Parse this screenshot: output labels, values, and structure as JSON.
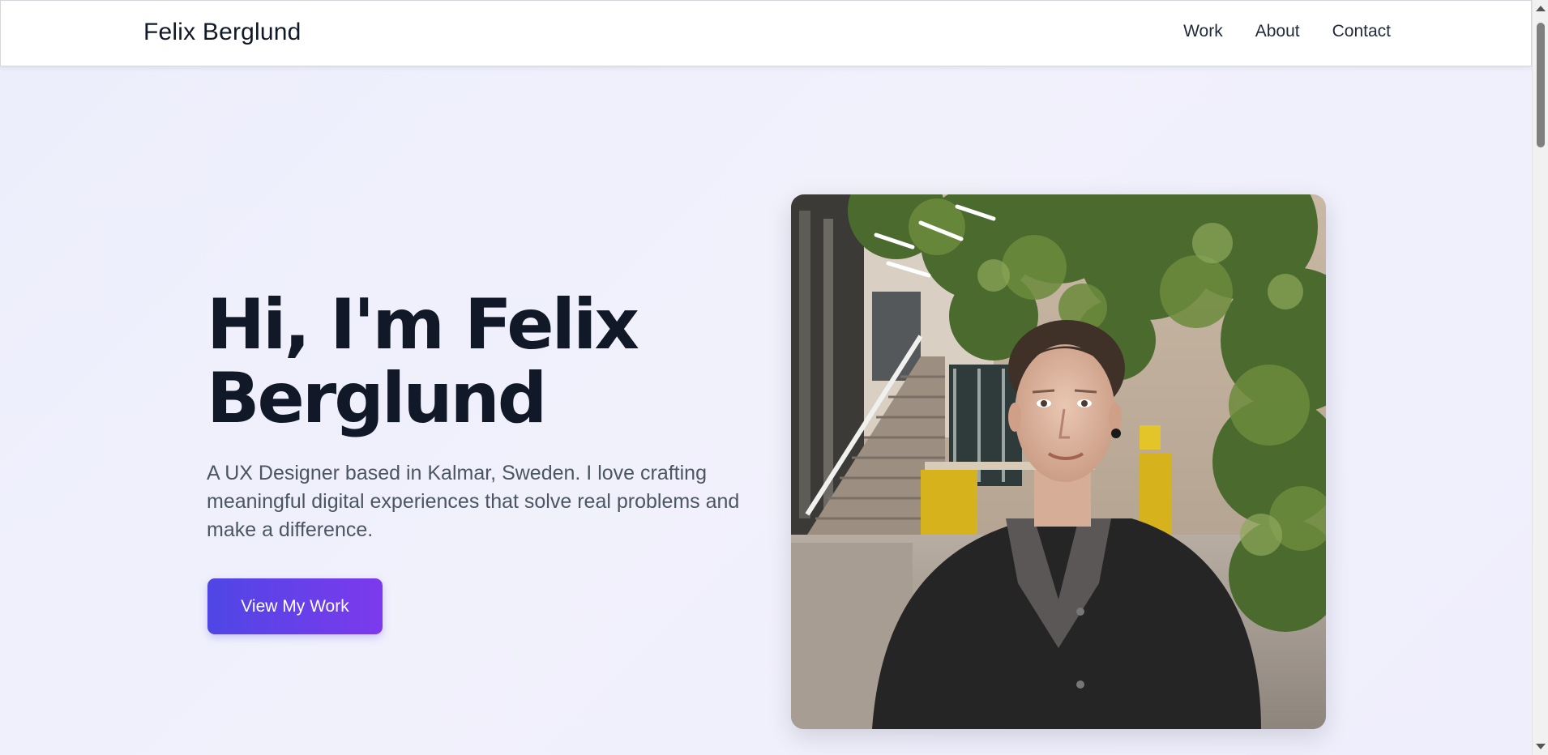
{
  "nav": {
    "brand": "Felix Berglund",
    "links": [
      "Work",
      "About",
      "Contact"
    ]
  },
  "hero": {
    "title_line1": "Hi, I'm Felix",
    "title_line2": "Berglund",
    "description": "A UX Designer based in Kalmar, Sweden. I love crafting meaningful digital experiences that solve real problems and make a difference.",
    "cta_label": "View My Work"
  },
  "colors": {
    "accent_start": "#4f46e5",
    "accent_end": "#7c3aed",
    "heading": "#111827",
    "body_text": "#4b5563"
  },
  "icons": {
    "scroll_up": "scroll-up-arrow-icon",
    "scroll_down": "scroll-down-arrow-icon"
  }
}
